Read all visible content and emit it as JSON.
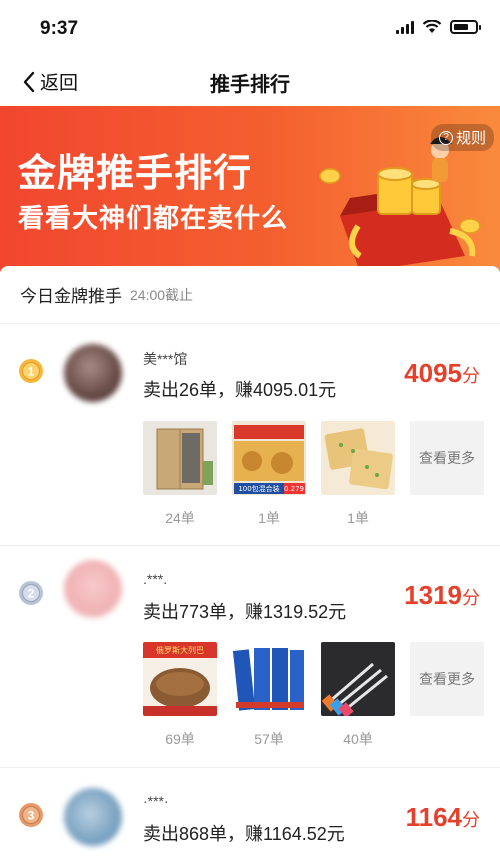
{
  "status_bar": {
    "time": "9:37"
  },
  "nav": {
    "back_label": "返回",
    "title": "推手排行"
  },
  "banner": {
    "title": "金牌推手排行",
    "subtitle": "看看大神们都在卖什么",
    "rules_label": "规则"
  },
  "list": {
    "header": "今日金牌推手",
    "cutoff": "24:00截止",
    "more_label": "查看更多",
    "rows": [
      {
        "rank": "1",
        "name": "美***馆",
        "sold": "卖出26单，赚4095.01元",
        "score": "4095",
        "unit": "分",
        "items": [
          {
            "count": "24单"
          },
          {
            "count": "1单",
            "overlay": "100包混合装",
            "badge": "0.279"
          },
          {
            "count": "1单"
          }
        ]
      },
      {
        "rank": "2",
        "name": ".***.",
        "sold": "卖出773单，赚1319.52元",
        "score": "1319",
        "unit": "分",
        "items": [
          {
            "count": "69单",
            "overlay": "俄罗斯大列巴"
          },
          {
            "count": "57单"
          },
          {
            "count": "40单"
          }
        ]
      },
      {
        "rank": "3",
        "name": "·***·",
        "sold": "卖出868单，赚1164.52元",
        "score": "1164",
        "unit": "分",
        "items": []
      }
    ]
  },
  "colors": {
    "accent": "#e5402c",
    "banner_start": "#f2462f",
    "banner_end": "#f98a3c",
    "gold": "#f6b73c",
    "silver": "#b9c3d6",
    "bronze": "#e49a6a"
  }
}
